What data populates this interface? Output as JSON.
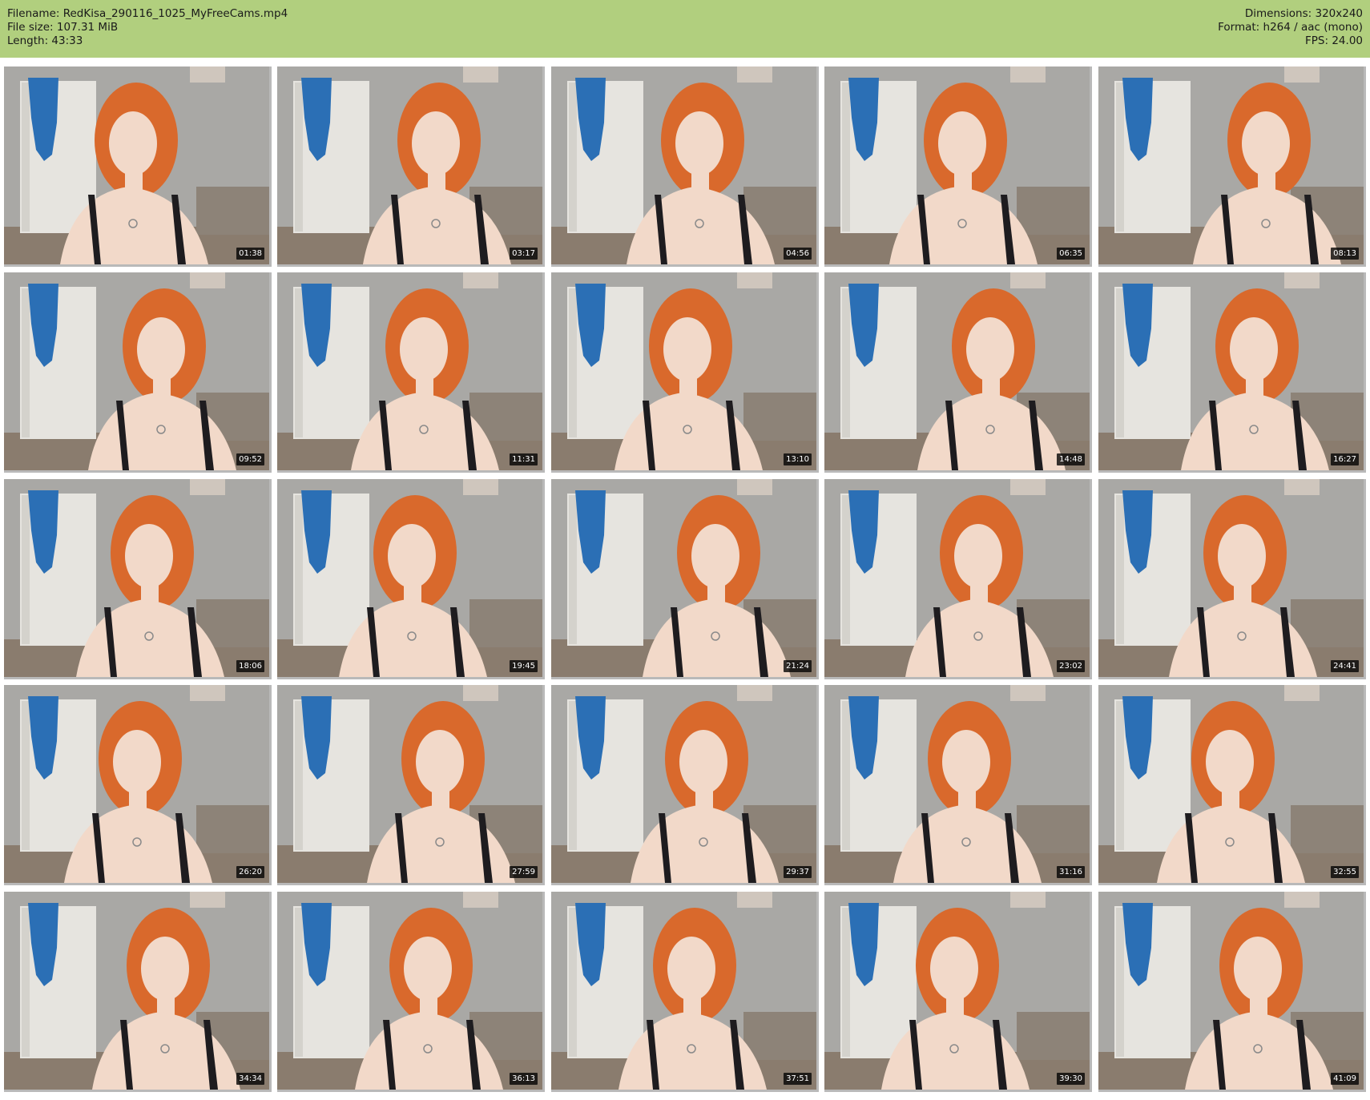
{
  "header": {
    "filename": "Filename: RedKisa_290116_1025_MyFreeCams.mp4",
    "filesize": "File size: 107.31 MiB",
    "length": "Length: 43:33",
    "dimensions": "Dimensions: 320x240",
    "format": "Format: h264 / aac (mono)",
    "fps": "FPS: 24.00"
  },
  "colors": {
    "header_bg": "#b1cf7e",
    "wall": "#a9a8a5",
    "door": "#e6e4df",
    "towel": "#2b6fb5",
    "hair": "#d9692c",
    "skin": "#f2d9c9",
    "top": "#1e1c1f",
    "floor": "#8a7c6e"
  },
  "thumbnails": [
    {
      "time": "01:38"
    },
    {
      "time": "03:17"
    },
    {
      "time": "04:56"
    },
    {
      "time": "06:35"
    },
    {
      "time": "08:13"
    },
    {
      "time": "09:52"
    },
    {
      "time": "11:31"
    },
    {
      "time": "13:10"
    },
    {
      "time": "14:48"
    },
    {
      "time": "16:27"
    },
    {
      "time": "18:06"
    },
    {
      "time": "19:45"
    },
    {
      "time": "21:24"
    },
    {
      "time": "23:02"
    },
    {
      "time": "24:41"
    },
    {
      "time": "26:20"
    },
    {
      "time": "27:59"
    },
    {
      "time": "29:37"
    },
    {
      "time": "31:16"
    },
    {
      "time": "32:55"
    },
    {
      "time": "34:34"
    },
    {
      "time": "36:13"
    },
    {
      "time": "37:51"
    },
    {
      "time": "39:30"
    },
    {
      "time": "41:09"
    }
  ]
}
